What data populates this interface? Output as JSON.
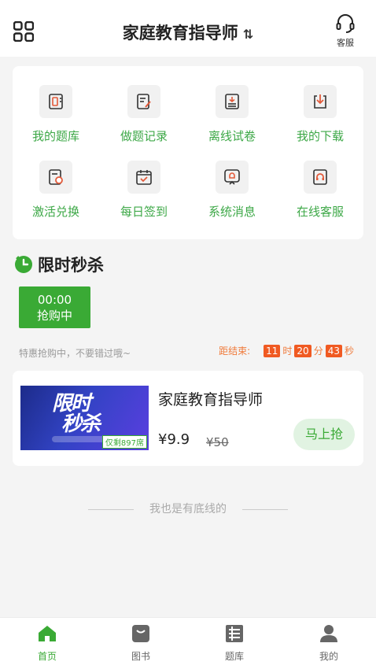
{
  "header": {
    "title": "家庭教育指导师",
    "switch_icon": "⇅",
    "service_label": "客服"
  },
  "menu": [
    {
      "label": "我的题库",
      "icon": "question-bank-icon"
    },
    {
      "label": "做题记录",
      "icon": "record-icon"
    },
    {
      "label": "离线试卷",
      "icon": "offline-paper-icon"
    },
    {
      "label": "我的下载",
      "icon": "download-icon"
    },
    {
      "label": "激活兑换",
      "icon": "activate-icon"
    },
    {
      "label": "每日签到",
      "icon": "calendar-check-icon"
    },
    {
      "label": "系统消息",
      "icon": "bell-icon"
    },
    {
      "label": "在线客服",
      "icon": "headset-icon"
    }
  ],
  "flash": {
    "title": "限时秒杀",
    "time_tab": {
      "time": "00:00",
      "status": "抢购中"
    },
    "promo_text": "特惠抢购中，不要错过哦~",
    "countdown": {
      "label": "距结束:",
      "hours": "11",
      "h_unit": "时",
      "minutes": "20",
      "m_unit": "分",
      "seconds": "43",
      "s_unit": "秒"
    }
  },
  "product": {
    "banner_text_line1": "限时",
    "banner_text_line2": "秒杀",
    "banner_tag": "仅剩897席",
    "title": "家庭教育指导师",
    "price": "¥9.9",
    "old_price": "¥50",
    "buy_label": "马上抢"
  },
  "end_text": "我也是有底线的",
  "tabs": [
    {
      "label": "首页",
      "active": true
    },
    {
      "label": "图书",
      "active": false
    },
    {
      "label": "题库",
      "active": false
    },
    {
      "label": "我的",
      "active": false
    }
  ],
  "colors": {
    "accent": "#3aaa35",
    "countdown": "#f05a22"
  }
}
